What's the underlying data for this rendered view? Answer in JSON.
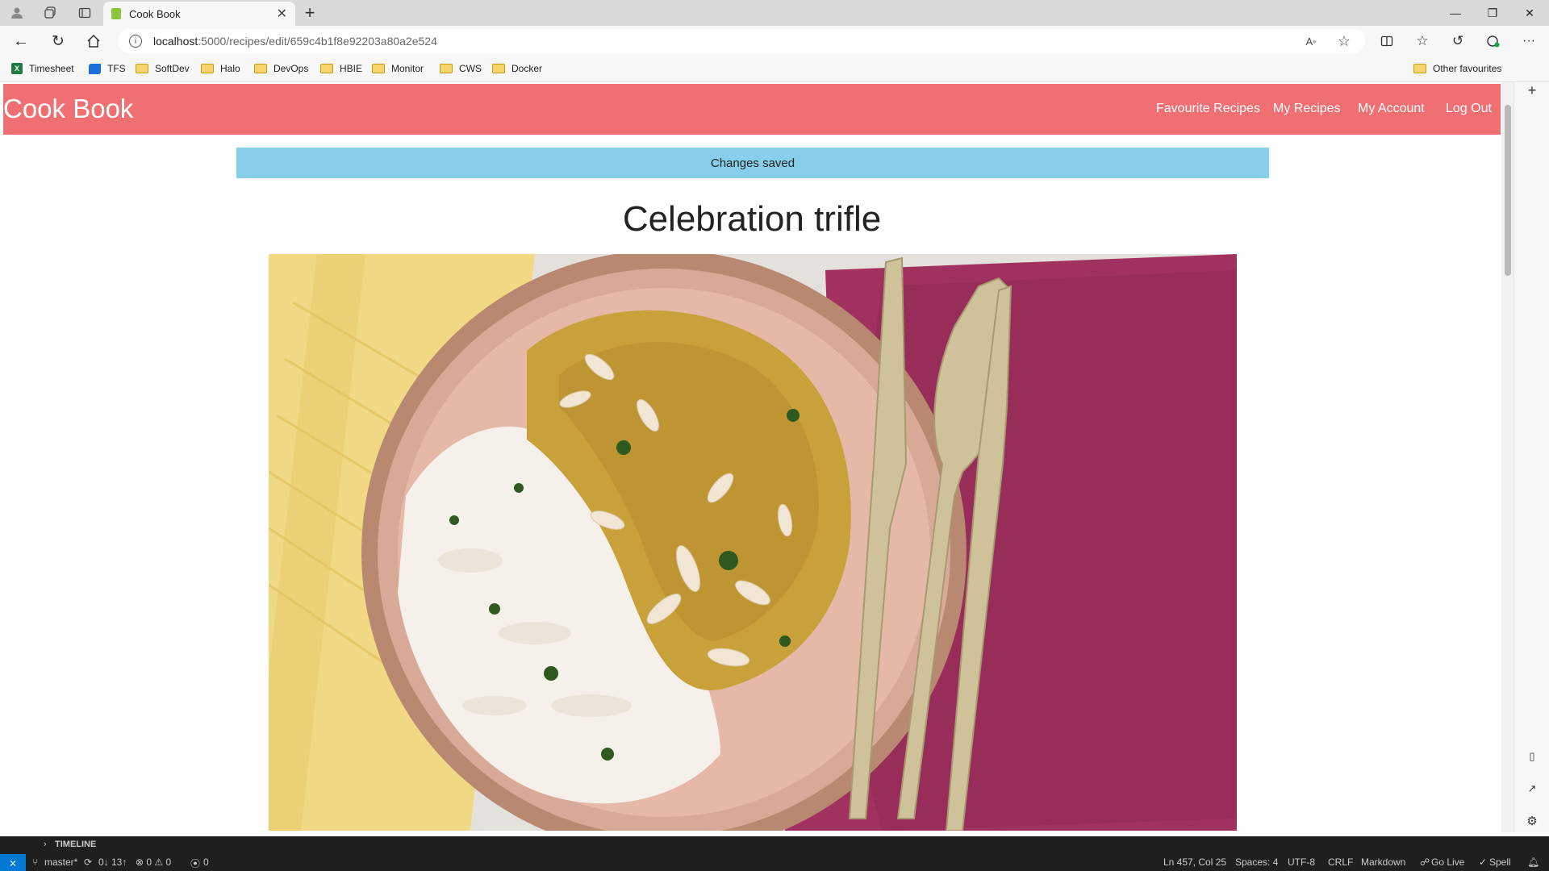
{
  "browser": {
    "tab_title": "Cook Book",
    "url_host": "localhost",
    "url_path": ":5000/recipes/edit/659c4b1f8e92203a80a2e524",
    "bookmarks": [
      "Timesheet",
      "TFS",
      "SoftDev",
      "Halo",
      "DevOps",
      "HBIE",
      "Monitor",
      "CWS",
      "Docker"
    ],
    "other_favourites": "Other favourites"
  },
  "app": {
    "brand": "Cook Book",
    "nav": [
      "Favourite Recipes",
      "My Recipes",
      "My Account",
      "Log Out"
    ],
    "alert": "Changes saved",
    "recipe_title": "Celebration trifle"
  },
  "vscode": {
    "timeline_label": "TIMELINE",
    "branch": "master*",
    "sync": "0↓ 13↑",
    "problems": "⊗ 0 ⚠ 0",
    "ports": "0",
    "position": "Ln 457, Col 25",
    "spaces": "Spaces: 4",
    "encoding": "UTF-8",
    "eol": "CRLF",
    "language": "Markdown",
    "golive": "Go Live",
    "spell": "Spell"
  },
  "icons": [
    "profile-icon",
    "workspaces-icon",
    "tab-actions-icon",
    "back-icon",
    "refresh-icon",
    "home-icon",
    "info-icon",
    "read-aloud-icon",
    "favorite-star-icon",
    "split-screen-icon",
    "favorites-icon",
    "history-icon",
    "extensions-icon",
    "more-icon",
    "add-tab-icon",
    "minimize-icon",
    "restore-icon",
    "close-window-icon"
  ],
  "colors": {
    "navbar": "#ef6f72",
    "alert": "#87ceeb"
  }
}
